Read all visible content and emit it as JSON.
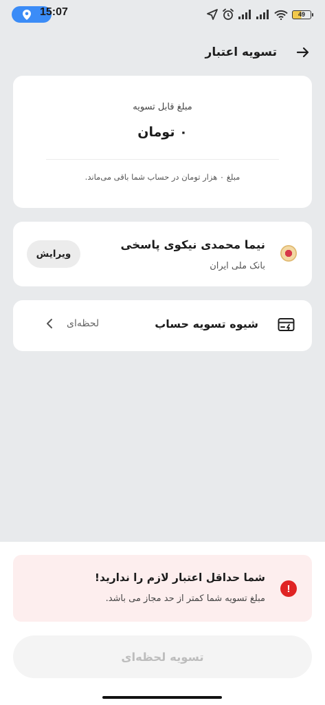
{
  "status_bar": {
    "time": "15:07",
    "battery": "49",
    "icons": [
      "location-pin-icon",
      "navigation-arrow-icon",
      "alarm-icon",
      "signal-icon",
      "signal-icon",
      "wifi-icon",
      "battery-icon"
    ]
  },
  "header": {
    "title": "تسویه اعتبار",
    "back_icon": "arrow-right-icon"
  },
  "amount_card": {
    "label": "مبلغ قابل تسویه",
    "value": "۰ تومان",
    "note": "مبلغ ۰ هزار تومان در حساب شما باقی می‌ماند."
  },
  "account_card": {
    "name": "نیما محمدی نیکوی پاسخی",
    "bank": "بانک ملی ایران",
    "edit_label": "ویرایش",
    "logo_icon": "bank-melli-logo"
  },
  "method_card": {
    "label": "شیوه تسویه حساب",
    "value": "لحظه‌ای",
    "icon": "card-transfer-icon",
    "chevron_icon": "chevron-left-icon"
  },
  "alert": {
    "title": "شما حداقل اعتبار لازم را ندارید!",
    "text": "مبلغ تسویه شما کمتر از حد مجاز می باشد.",
    "icon": "error-icon",
    "icon_glyph": "!",
    "color": "#e02424"
  },
  "submit": {
    "label": "تسویه لحظه‌ای"
  },
  "colors": {
    "background": "#e8eaec",
    "location_pill": "#3b8cf7",
    "alert_background": "#fdeeee"
  }
}
